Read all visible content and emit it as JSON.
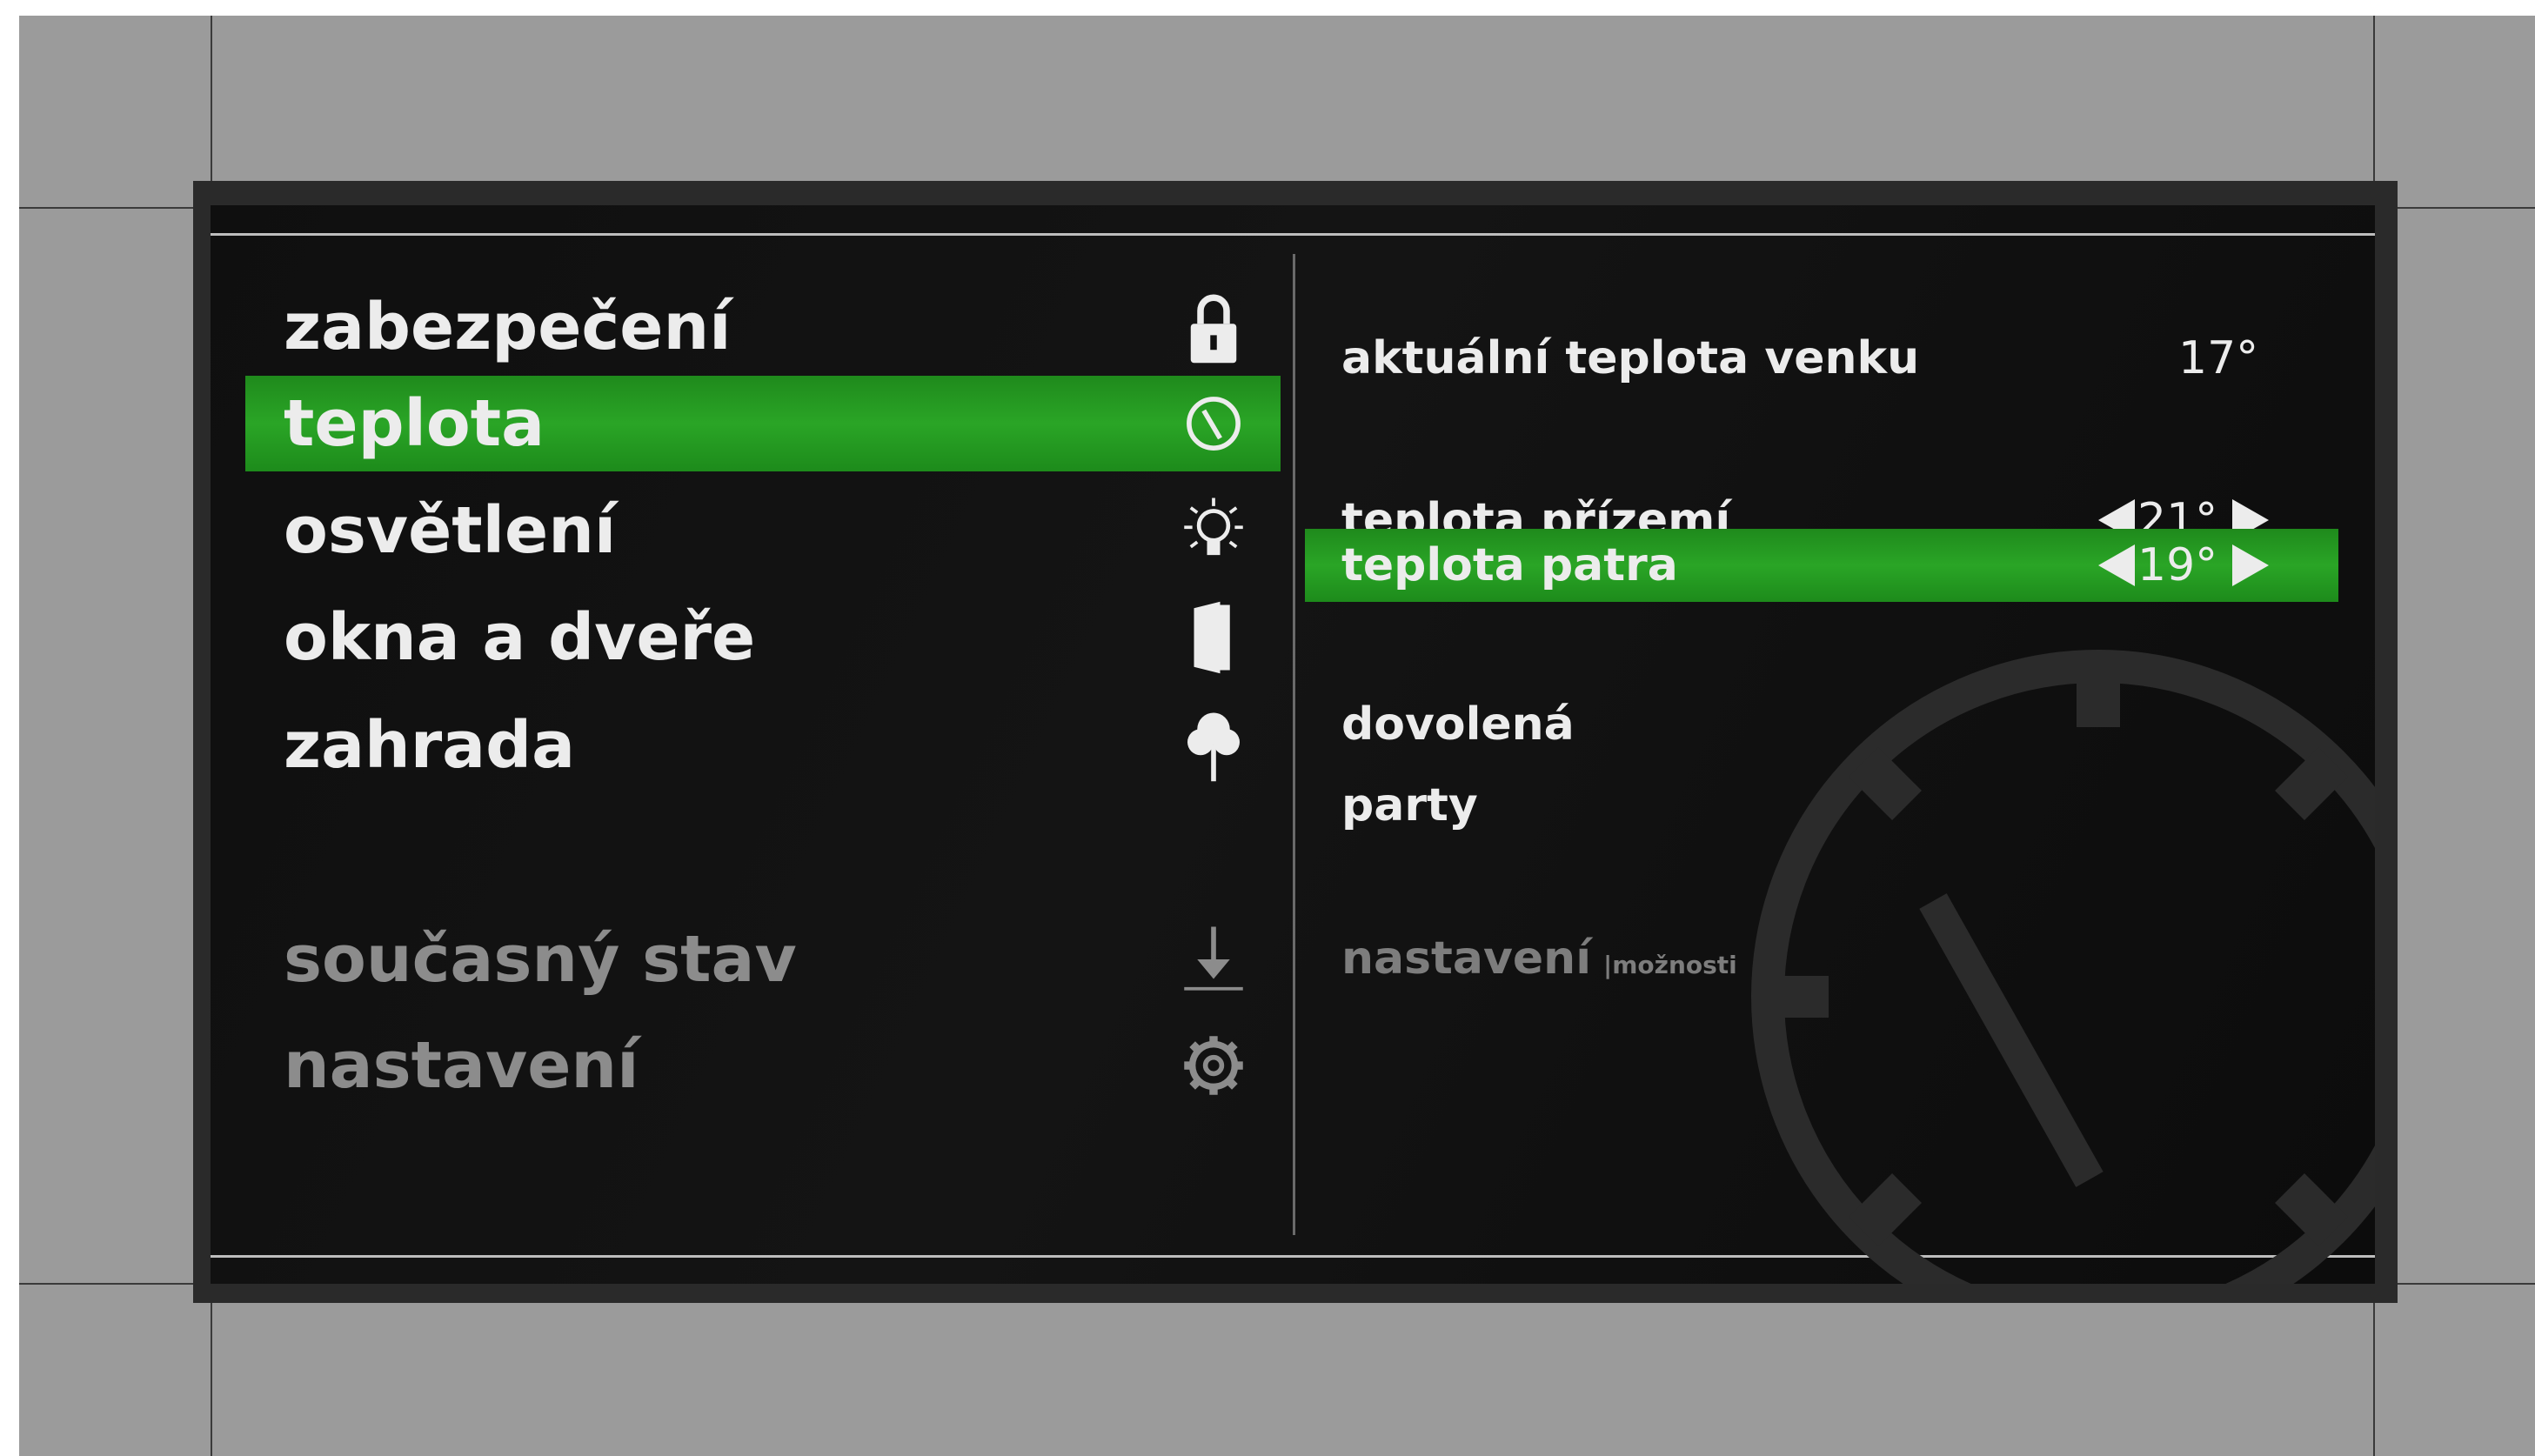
{
  "menu": {
    "items": [
      {
        "label": "zabezpečení",
        "icon": "lock-icon"
      },
      {
        "label": "teplota",
        "icon": "thermostat-icon",
        "active": true
      },
      {
        "label": "osvětlení",
        "icon": "lightbulb-icon"
      },
      {
        "label": "okna a dveře",
        "icon": "door-icon"
      },
      {
        "label": "zahrada",
        "icon": "tree-icon"
      }
    ],
    "secondary": [
      {
        "label": "současný stav",
        "icon": "download-icon"
      },
      {
        "label": "nastavení",
        "icon": "gear-icon"
      }
    ]
  },
  "temperature": {
    "outdoor": {
      "label": "aktuální teplota venku",
      "value": "17°"
    },
    "ground_floor": {
      "label": "teplota přízemí",
      "value": "21°"
    },
    "upper_floor": {
      "label": "teplota patra",
      "value": "19°",
      "active": true
    },
    "modes": [
      "dovolená",
      "party"
    ],
    "settings": {
      "label": "nastavení",
      "sub": "|možnosti"
    }
  },
  "colors": {
    "accent": "#27a023",
    "screen_bg": "#111111",
    "text": "#ececec",
    "dim_text": "#8c8c8c",
    "mockup_bg": "#9b9b9b"
  }
}
